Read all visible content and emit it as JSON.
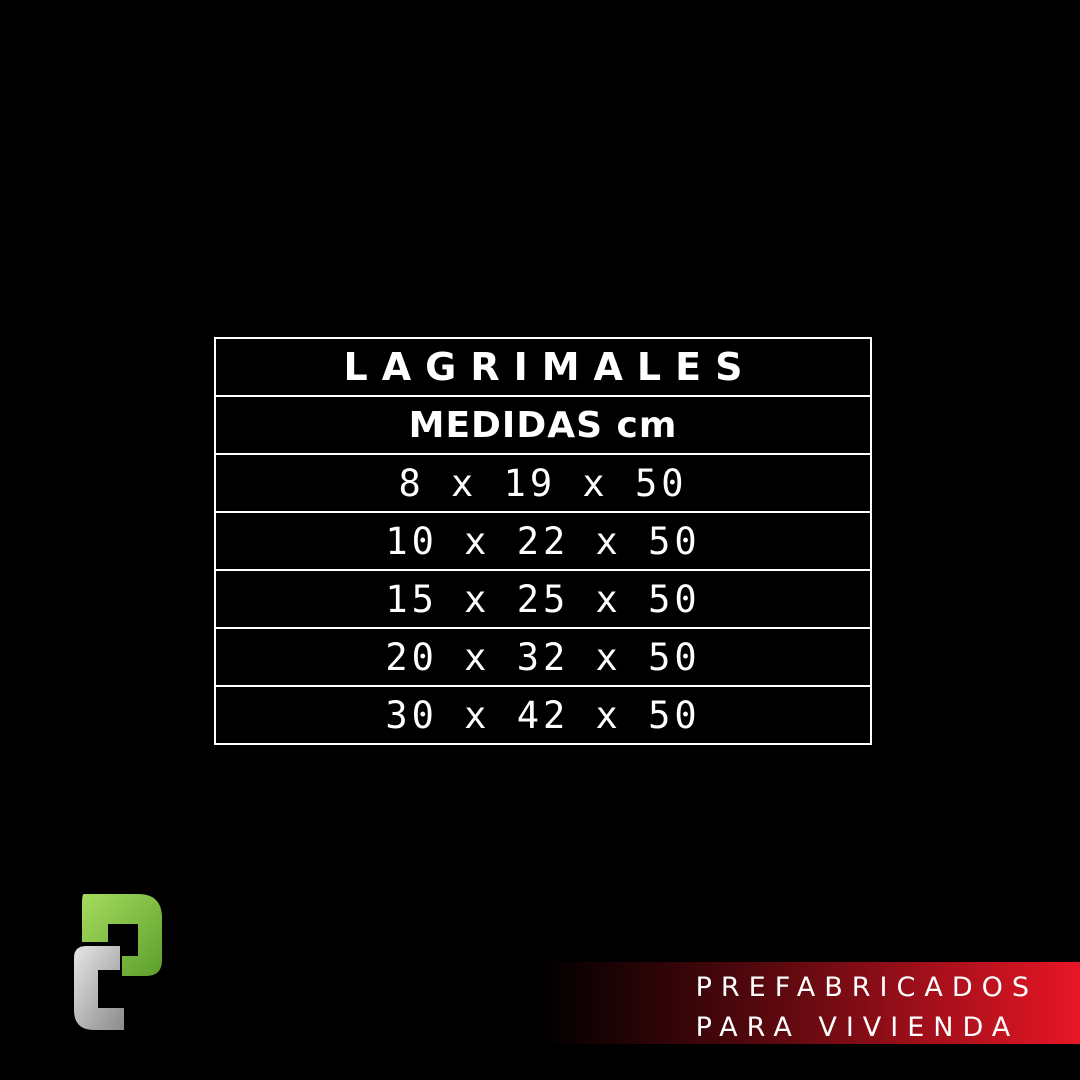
{
  "table": {
    "title": "LAGRIMALES",
    "subtitle": "MEDIDAS cm",
    "rows": [
      "8 x 19 x 50",
      "10 x 22 x 50",
      "15 x 25 x 50",
      "20 x 32 x 50",
      "30 x 42 x 50"
    ]
  },
  "banner": {
    "line1": "PREFABRICADOS",
    "line2": "PARA VIVIENDA"
  },
  "colors": {
    "background": "#000000",
    "text": "#ffffff",
    "accent_red": "#e81626",
    "logo_green": "#7cc242",
    "logo_gray": "#b3b3b3"
  },
  "logo": {
    "icon": "company-logo-icon"
  }
}
